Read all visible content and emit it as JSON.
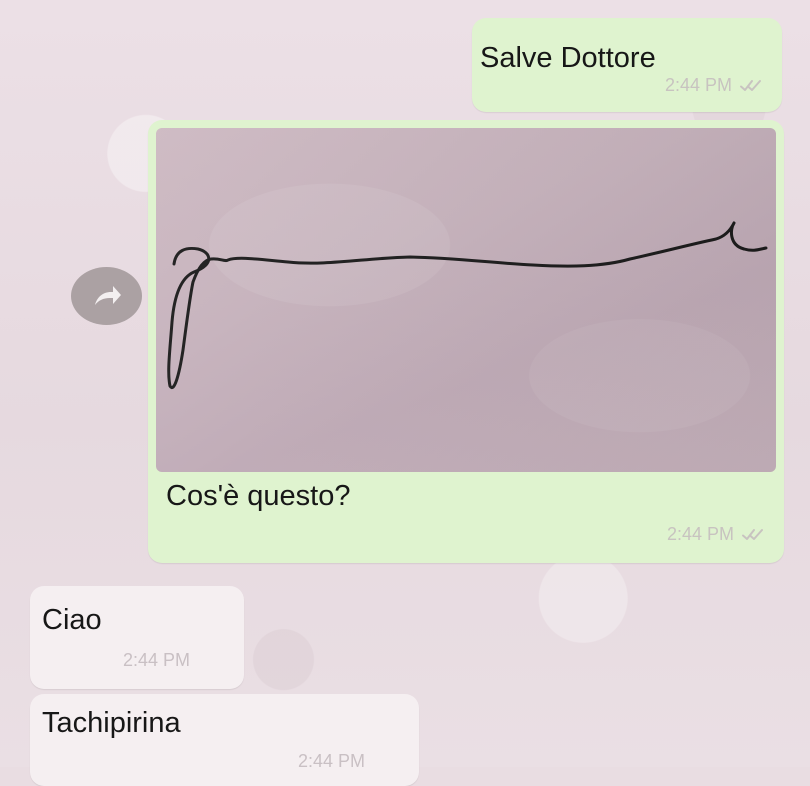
{
  "messages": [
    {
      "direction": "outgoing",
      "text": "Salve Dottore",
      "time": "2:44 PM",
      "status": "double-check"
    },
    {
      "direction": "outgoing",
      "type": "image-with-caption",
      "image_subject": "handwritten-signature",
      "caption": "Cos'è questo?",
      "time": "2:44 PM",
      "status": "double-check"
    },
    {
      "direction": "incoming",
      "text": "Ciao",
      "time": "2:44 PM"
    },
    {
      "direction": "incoming",
      "text": "Tachipirina",
      "time": "2:44 PM"
    }
  ],
  "actions": {
    "forward_icon": "forward-icon"
  },
  "colors": {
    "outgoing_bubble": "#dff3cf",
    "incoming_bubble": "#f5eff1",
    "chat_background": "#e9dde2",
    "timestamp": "#c8c3c0",
    "forward_button": "#aba1a3"
  }
}
